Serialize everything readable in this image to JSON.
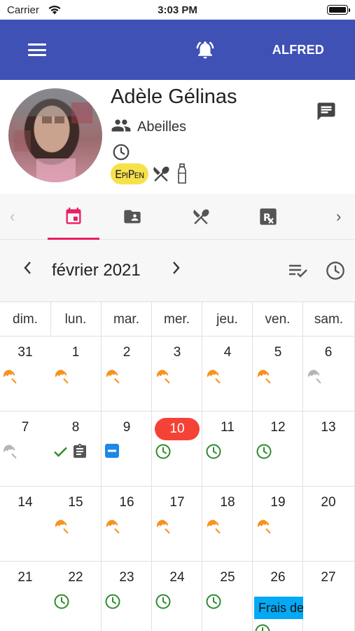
{
  "status_bar": {
    "carrier": "Carrier",
    "time": "3:03 PM"
  },
  "app_bar": {
    "user_label": "ALFRED",
    "color": "#3f51b5"
  },
  "profile": {
    "name": "Adèle Gélinas",
    "group": "Abeilles",
    "badge_epipen": "EpiPen",
    "icons": [
      "group-icon",
      "clock-icon",
      "epipen-badge",
      "utensils-icon",
      "bottle-icon",
      "message-icon"
    ]
  },
  "tabs": [
    {
      "icon": "calendar-icon",
      "active": true
    },
    {
      "icon": "contact-folder-icon",
      "active": false
    },
    {
      "icon": "utensils-icon",
      "active": false
    },
    {
      "icon": "prescription-icon",
      "active": false
    }
  ],
  "accent_color": "#e91e63",
  "calendar": {
    "month_title": "février 2021",
    "weekdays": [
      "dim.",
      "lun.",
      "mar.",
      "mer.",
      "jeu.",
      "ven.",
      "sam."
    ],
    "today": "10",
    "today_color": "#f44336",
    "weeks": [
      [
        {
          "day": "31",
          "icons": [
            "umbrella-orange"
          ]
        },
        {
          "day": "1",
          "icons": [
            "umbrella-orange"
          ]
        },
        {
          "day": "2",
          "icons": [
            "umbrella-orange"
          ]
        },
        {
          "day": "3",
          "icons": [
            "umbrella-orange"
          ]
        },
        {
          "day": "4",
          "icons": [
            "umbrella-orange"
          ]
        },
        {
          "day": "5",
          "icons": [
            "umbrella-orange"
          ]
        },
        {
          "day": "6",
          "icons": [
            "umbrella-grey"
          ]
        }
      ],
      [
        {
          "day": "7",
          "icons": [
            "umbrella-grey"
          ]
        },
        {
          "day": "8",
          "icons": [
            "check",
            "clipboard"
          ]
        },
        {
          "day": "9",
          "icons": [
            "minus-box"
          ]
        },
        {
          "day": "10",
          "icons": [
            "clock-green"
          ]
        },
        {
          "day": "11",
          "icons": [
            "clock-green"
          ]
        },
        {
          "day": "12",
          "icons": [
            "clock-green"
          ]
        },
        {
          "day": "13",
          "icons": []
        }
      ],
      [
        {
          "day": "14",
          "icons": []
        },
        {
          "day": "15",
          "icons": [
            "umbrella-orange"
          ]
        },
        {
          "day": "16",
          "icons": [
            "umbrella-orange"
          ]
        },
        {
          "day": "17",
          "icons": [
            "umbrella-orange"
          ]
        },
        {
          "day": "18",
          "icons": [
            "umbrella-orange"
          ]
        },
        {
          "day": "19",
          "icons": [
            "umbrella-orange"
          ]
        },
        {
          "day": "20",
          "icons": []
        }
      ],
      [
        {
          "day": "21",
          "icons": []
        },
        {
          "day": "22",
          "icons": [
            "clock-green"
          ]
        },
        {
          "day": "23",
          "icons": [
            "clock-green"
          ]
        },
        {
          "day": "24",
          "icons": [
            "clock-green"
          ]
        },
        {
          "day": "25",
          "icons": [
            "clock-green"
          ]
        },
        {
          "day": "26",
          "icons": [
            "clock-green"
          ],
          "event": "Frais de"
        },
        {
          "day": "27",
          "icons": []
        }
      ]
    ],
    "event_color": "#03a9f4",
    "umbrella_color": "#f7921e",
    "clock_color": "#2e8b2e"
  }
}
